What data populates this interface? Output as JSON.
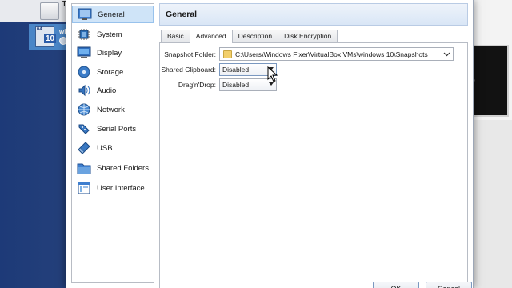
{
  "background": {
    "toolbar_label": "Too",
    "vm": {
      "name": "wind",
      "badge_top": "64",
      "badge_bottom": "10"
    },
    "preview_text": "0"
  },
  "sidebar": {
    "items": [
      {
        "label": "General",
        "icon": "general-icon",
        "active": true
      },
      {
        "label": "System",
        "icon": "system-icon"
      },
      {
        "label": "Display",
        "icon": "display-icon"
      },
      {
        "label": "Storage",
        "icon": "storage-icon"
      },
      {
        "label": "Audio",
        "icon": "audio-icon"
      },
      {
        "label": "Network",
        "icon": "network-icon"
      },
      {
        "label": "Serial Ports",
        "icon": "serial-ports-icon"
      },
      {
        "label": "USB",
        "icon": "usb-icon"
      },
      {
        "label": "Shared Folders",
        "icon": "shared-folders-icon"
      },
      {
        "label": "User Interface",
        "icon": "user-interface-icon"
      }
    ]
  },
  "main": {
    "title": "General",
    "tabs": [
      {
        "label": "Basic"
      },
      {
        "label": "Advanced",
        "active": true
      },
      {
        "label": "Description"
      },
      {
        "label": "Disk Encryption"
      }
    ],
    "advanced": {
      "snapshot_folder_label": "Snapshot Folder:",
      "snapshot_folder_value": "C:\\Users\\Windows Fixer\\VirtualBox VMs\\windows 10\\Snapshots",
      "shared_clipboard_label": "Shared Clipboard:",
      "shared_clipboard_value": "Disabled",
      "drag_drop_label": "Drag'n'Drop:",
      "drag_drop_value": "Disabled"
    }
  },
  "buttons": {
    "ok_label": "OK",
    "cancel_label": "Cancel"
  }
}
